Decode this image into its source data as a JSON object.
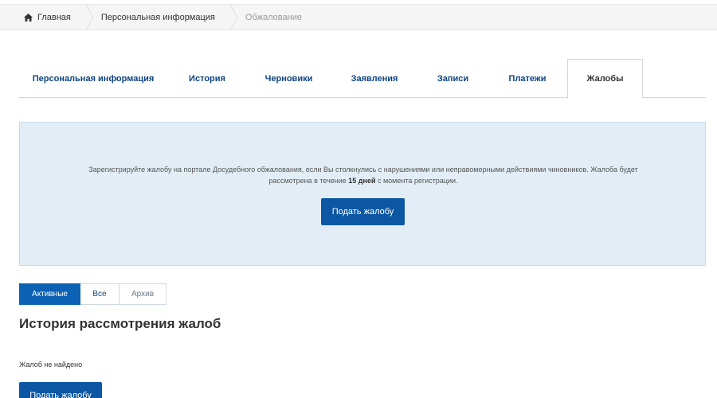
{
  "breadcrumb": {
    "home_label": "Главная",
    "personal_label": "Персональная информация",
    "current_label": "Обжалование"
  },
  "tabs": [
    {
      "label": "Персональная информация"
    },
    {
      "label": "История"
    },
    {
      "label": "Черновики"
    },
    {
      "label": "Заявления"
    },
    {
      "label": "Записи"
    },
    {
      "label": "Платежи"
    },
    {
      "label": "Жалобы",
      "active": true
    }
  ],
  "info": {
    "text_before": "Зарегистрируйте жалобу на портале Досудебного обжалования, если Вы столкнулись с нарушениями или неправомерными действиями чиновников. Жалоба будет рассмотрена в течение ",
    "text_bold": "15 дней",
    "text_after": " с момента регистрации.",
    "button_label": "Подать жалобу"
  },
  "filters": [
    {
      "label": "Активные",
      "selected": true
    },
    {
      "label": "Все"
    },
    {
      "label": "Архив"
    }
  ],
  "section": {
    "title": "История рассмотрения жалоб",
    "empty_text": "Жалоб не найдено",
    "button_label": "Подать жалобу"
  },
  "colors": {
    "accent": "#0b57a4",
    "tab_text": "#0d4382",
    "info_bg": "#e2edf5"
  },
  "icons": {
    "home": "home-icon"
  }
}
